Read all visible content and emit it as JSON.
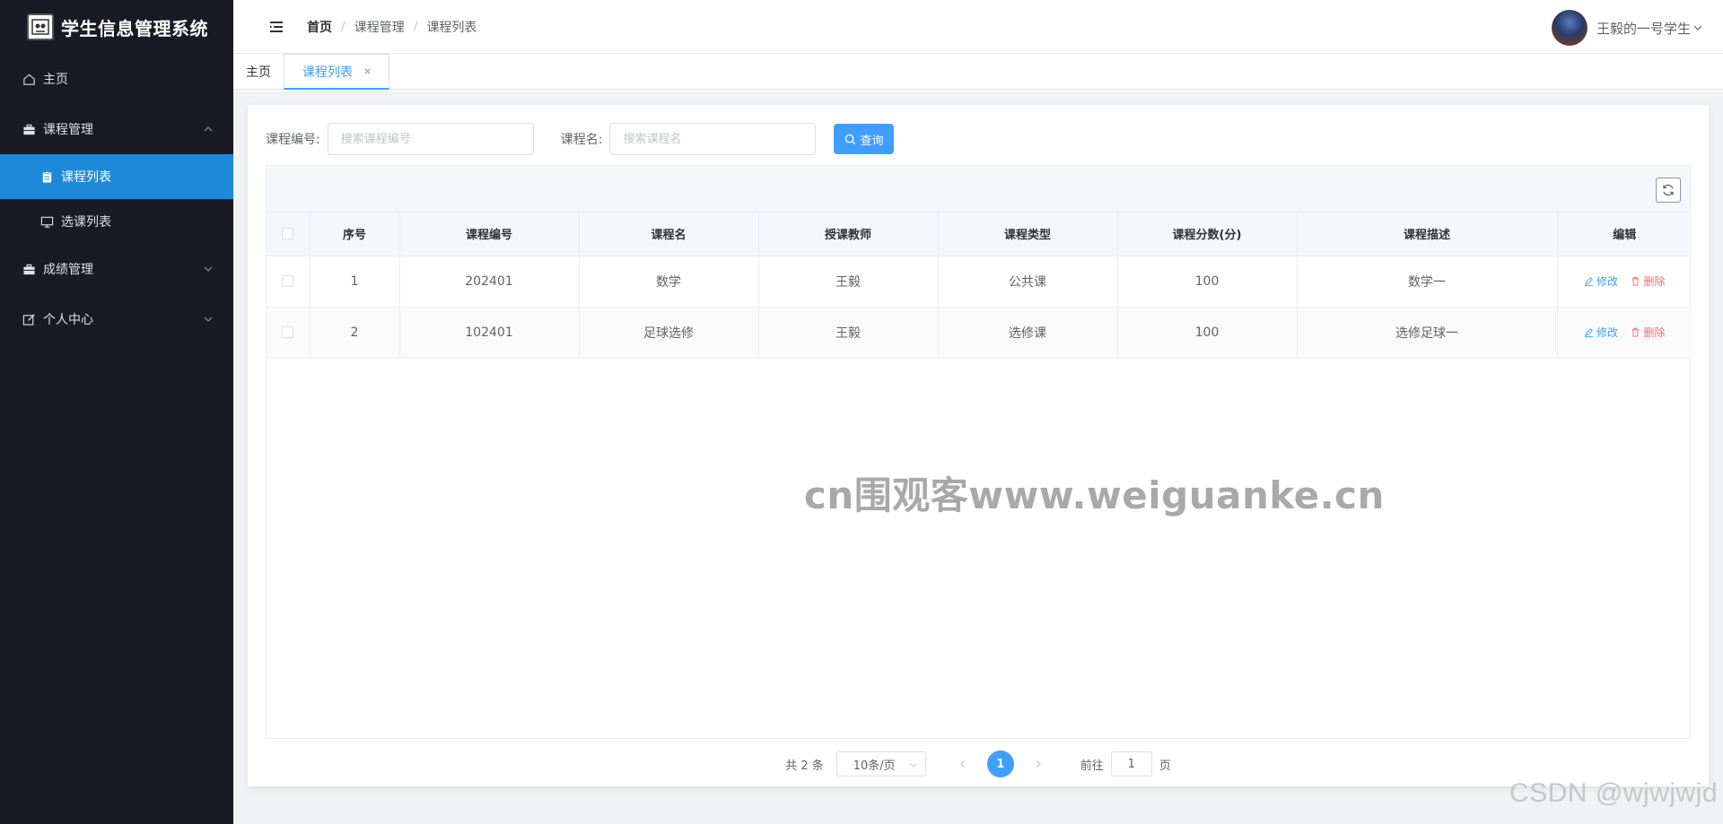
{
  "app": {
    "title": "学生信息管理系统"
  },
  "sidebar": {
    "items": [
      {
        "label": "主页",
        "icon": "home-icon"
      },
      {
        "label": "课程管理",
        "icon": "briefcase-icon",
        "expanded": true,
        "children": [
          {
            "label": "课程列表",
            "icon": "clipboard-icon",
            "active": true
          },
          {
            "label": "选课列表",
            "icon": "monitor-icon"
          }
        ]
      },
      {
        "label": "成绩管理",
        "icon": "briefcase-icon"
      },
      {
        "label": "个人中心",
        "icon": "edit-icon"
      }
    ]
  },
  "header": {
    "breadcrumb": [
      "首页",
      "课程管理",
      "课程列表"
    ],
    "breadcrumb_sep": "/",
    "user_name": "王毅的一号学生"
  },
  "tabs": [
    {
      "label": "主页"
    },
    {
      "label": "课程列表",
      "active": true,
      "closable": true
    }
  ],
  "search": {
    "course_no_label": "课程编号:",
    "course_no_placeholder": "搜索课程编号",
    "course_name_label": "课程名:",
    "course_name_placeholder": "搜索课程名",
    "query_label": "查询"
  },
  "table": {
    "columns": [
      "序号",
      "课程编号",
      "课程名",
      "授课教师",
      "课程类型",
      "课程分数(分)",
      "课程描述",
      "编辑"
    ],
    "rows": [
      {
        "index": "1",
        "course_no": "202401",
        "name": "数学",
        "teacher": "王毅",
        "type": "公共课",
        "score": "100",
        "desc": "数学一"
      },
      {
        "index": "2",
        "course_no": "102401",
        "name": "足球选修",
        "teacher": "王毅",
        "type": "选修课",
        "score": "100",
        "desc": "选修足球一"
      }
    ],
    "edit_label": "修改",
    "delete_label": "删除"
  },
  "watermark": "cn围观客www.weiguanke.cn",
  "pagination": {
    "total_text": "共 2 条",
    "page_size": "10条/页",
    "current_page": "1",
    "goto_prefix": "前往",
    "goto_value": "1",
    "goto_suffix": "页"
  },
  "csdn_watermark": "CSDN @wjwjwjd",
  "colors": {
    "primary": "#409eff",
    "danger": "#f56c6c",
    "sidebar_bg": "#191a23",
    "active_menu": "#1e89d8"
  }
}
